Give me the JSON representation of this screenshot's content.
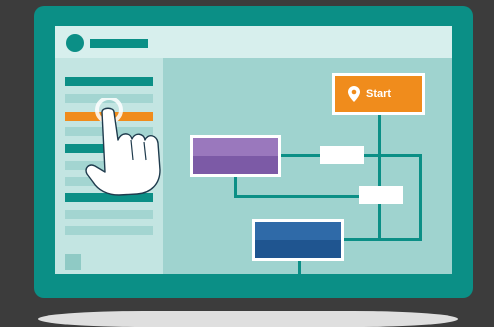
{
  "flow": {
    "start_label": "Start"
  },
  "colors": {
    "background": "#3c3c3c",
    "device": "#0b8f86",
    "screen": "#9fd3cf",
    "accent_orange": "#f08c1c",
    "purple": "#8a67b1",
    "blue": "#2a62a0"
  },
  "icons": {
    "start": "location-pin-icon",
    "pointer": "pointing-hand-icon"
  }
}
